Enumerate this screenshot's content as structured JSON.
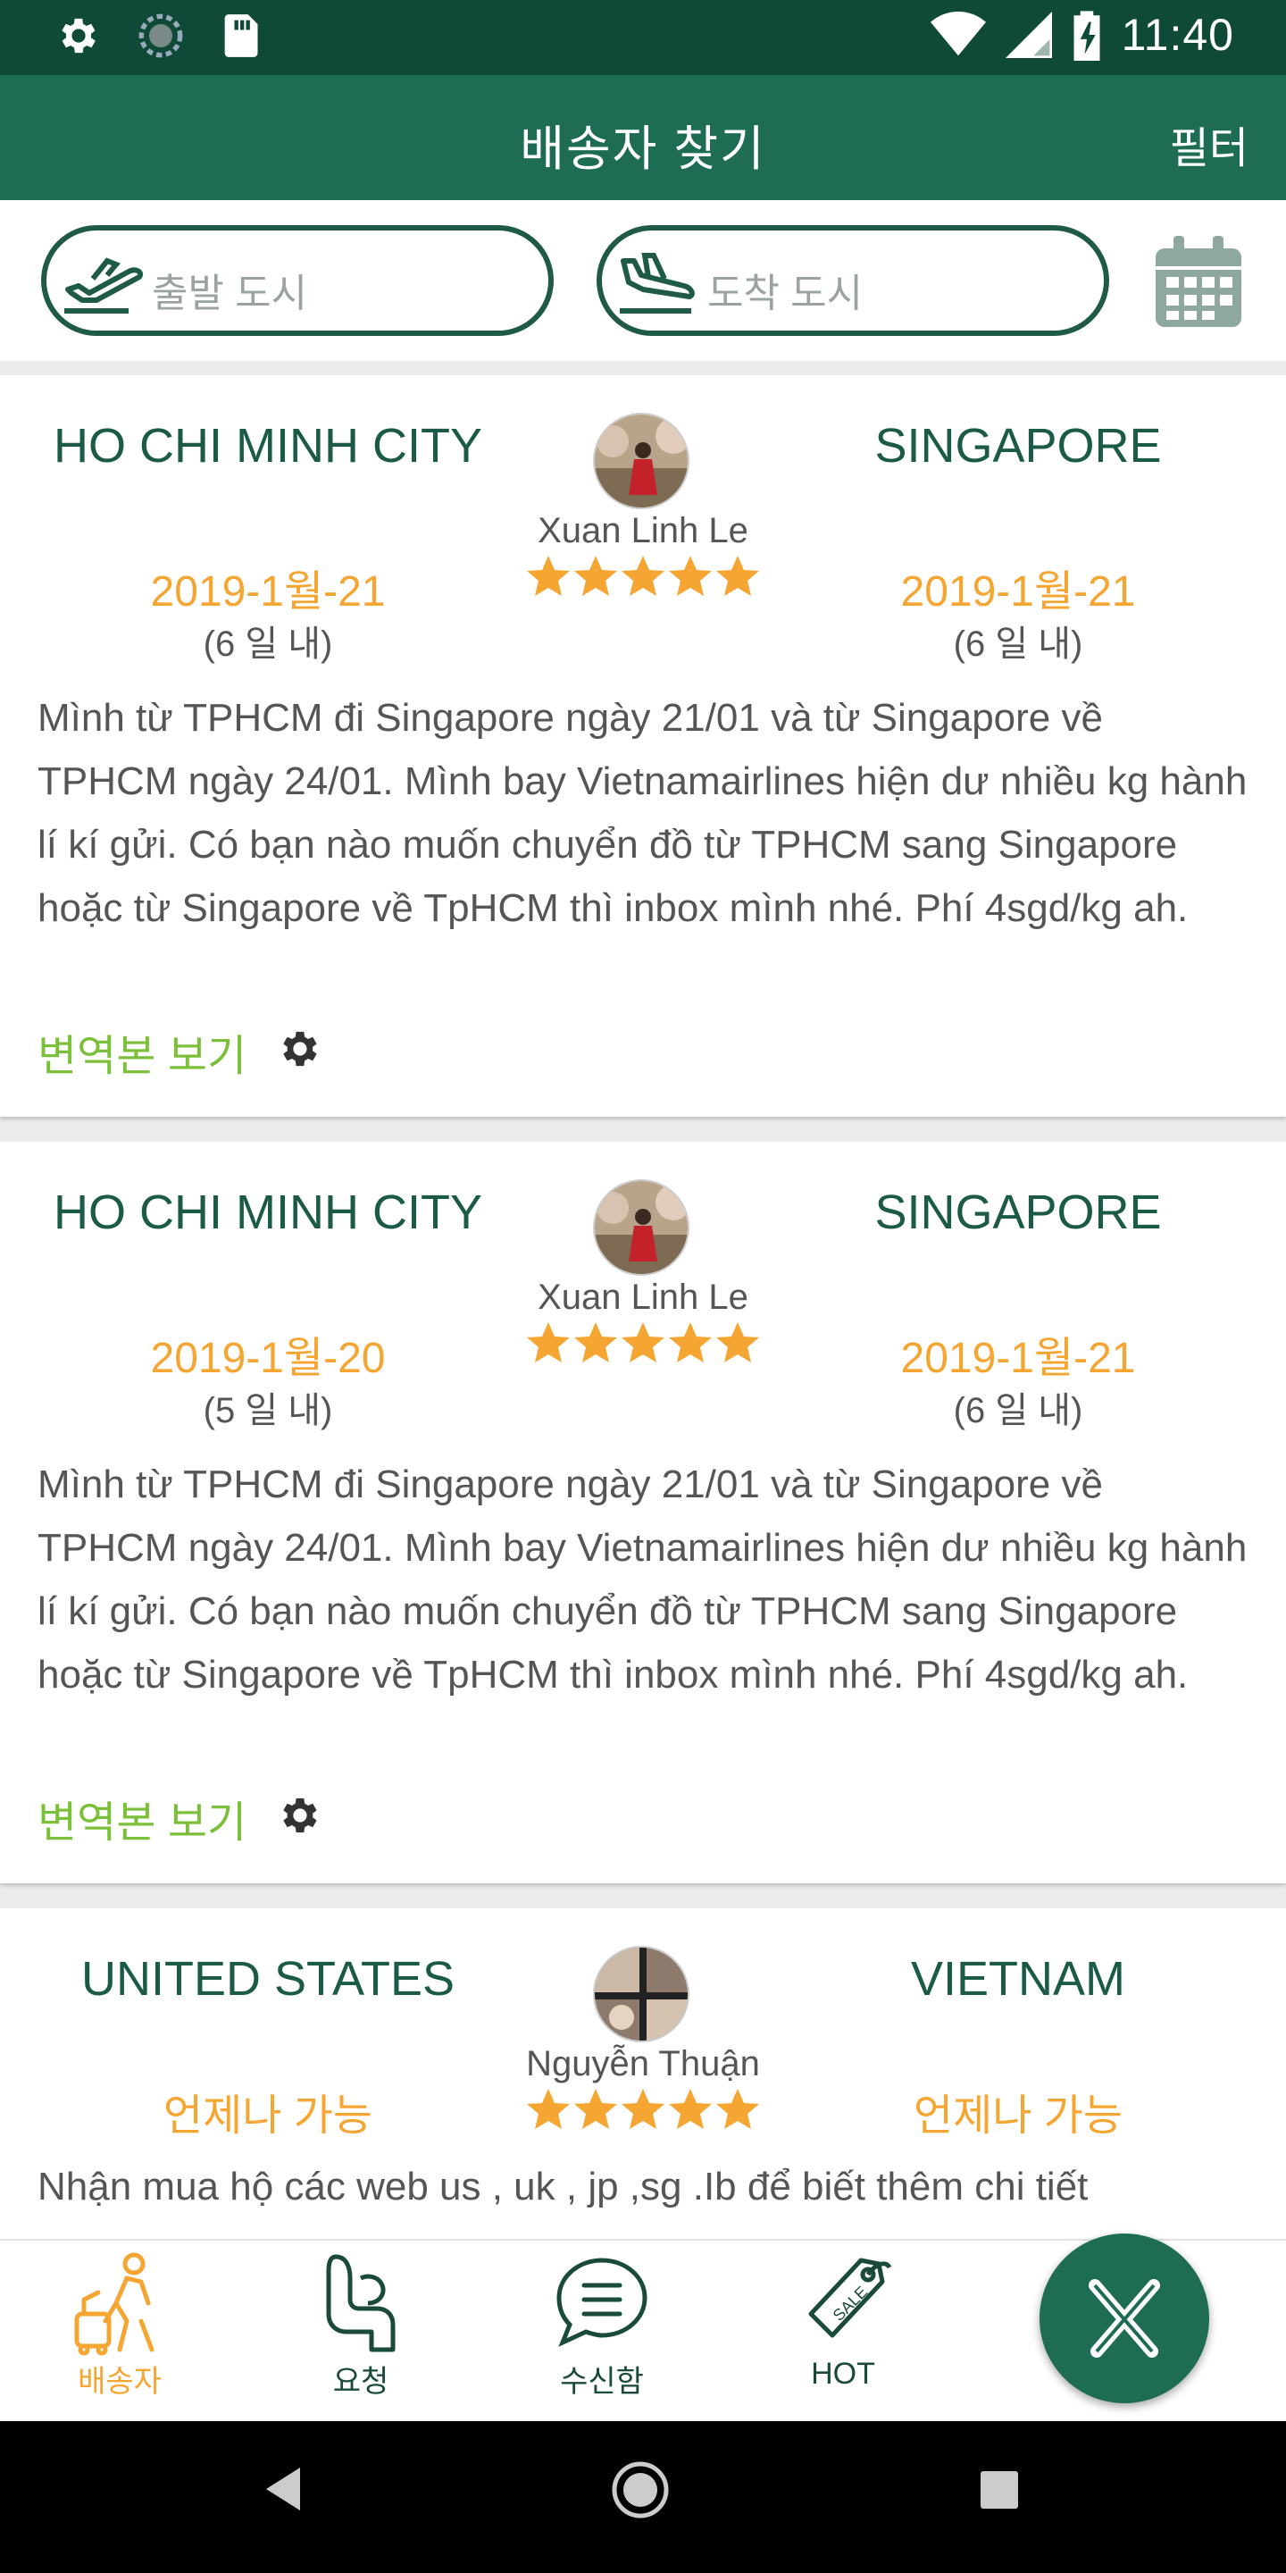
{
  "status_bar": {
    "time": "11:40",
    "left_icons": [
      "settings-icon",
      "sync-icon",
      "sd-card-icon"
    ],
    "right_icons": [
      "wifi-icon",
      "signal-icon",
      "battery-charging-icon"
    ]
  },
  "header": {
    "title": "배송자 찾기",
    "filter_label": "필터"
  },
  "search": {
    "from_placeholder": "출발 도시",
    "to_placeholder": "도착 도시",
    "calendar_icon": "calendar-icon"
  },
  "colors": {
    "primary_dark": "#0e4a37",
    "primary": "#1f6c55",
    "accent": "#f5a532",
    "link": "#7cbf3a",
    "star": "#f5a532"
  },
  "listings": [
    {
      "from_city": "HO CHI MINH CITY",
      "to_city": "SINGAPORE",
      "sender": "Xuan Linh Le",
      "rating": 5,
      "from_date": "2019-1월-21",
      "from_within": "(6 일 내)",
      "to_date": "2019-1월-21",
      "to_within": "(6 일 내)",
      "description": "Mình từ TPHCM đi Singapore ngày 21/01 và từ Singapore về TPHCM ngày 24/01. Mình bay Vietnamairlines hiện dư nhiều kg hành lí kí gửi. Có bạn nào muốn chuyển đồ từ TPHCM sang Singapore hoặc từ Singapore về TpHCM thì inbox mình nhé. Phí 4sgd/kg ah.",
      "translate_label": "변역본 보기"
    },
    {
      "from_city": "HO CHI MINH CITY",
      "to_city": "SINGAPORE",
      "sender": "Xuan Linh Le",
      "rating": 5,
      "from_date": "2019-1월-20",
      "from_within": "(5 일 내)",
      "to_date": "2019-1월-21",
      "to_within": "(6 일 내)",
      "description": "Mình từ TPHCM đi Singapore ngày 21/01 và từ Singapore về TPHCM ngày 24/01. Mình bay Vietnamairlines hiện dư nhiều kg hành lí kí gửi. Có bạn nào muốn chuyển đồ từ TPHCM sang Singapore hoặc từ Singapore về TpHCM thì inbox mình nhé. Phí 4sgd/kg ah.",
      "translate_label": "변역본 보기"
    },
    {
      "from_city": "UNITED STATES",
      "to_city": "VIETNAM",
      "sender": "Nguyễn Thuận",
      "rating": 5,
      "from_date": "언제나 가능",
      "to_date": "언제나 가능",
      "description": "Nhận mua hộ các web us , uk , jp ,sg .Ib để biết thêm chi tiết"
    }
  ],
  "bottom_nav": {
    "items": [
      {
        "label": "배송자",
        "icon": "traveler-icon",
        "active": true
      },
      {
        "label": "요청",
        "icon": "request-seat-icon",
        "active": false
      },
      {
        "label": "수신함",
        "icon": "inbox-chat-icon",
        "active": false
      },
      {
        "label": "HOT",
        "icon": "sale-tag-icon",
        "active": false
      }
    ],
    "fab_icon": "app-logo-x-icon"
  },
  "system_nav": [
    "back-icon",
    "home-icon",
    "recents-icon"
  ]
}
